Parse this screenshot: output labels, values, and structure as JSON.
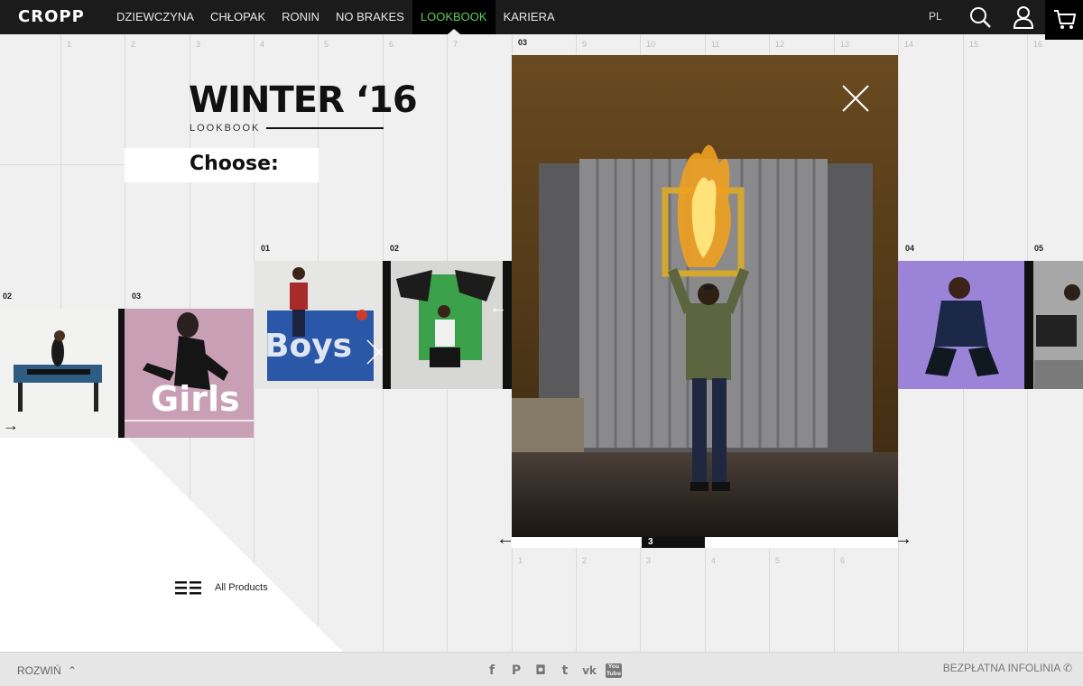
{
  "header": {
    "logo": "CROPP",
    "nav": [
      {
        "label": "DZIEWCZYNA"
      },
      {
        "label": "CHŁOPAK"
      },
      {
        "label": "RONIN"
      },
      {
        "label": "NO BRAKES"
      },
      {
        "label": "LOOKBOOK",
        "active": true
      },
      {
        "label": "KARIERA"
      }
    ],
    "language": "PL"
  },
  "grid": {
    "top_numbers": [
      "1",
      "2",
      "3",
      "4",
      "5",
      "6",
      "7",
      "03",
      "9",
      "10",
      "11",
      "12",
      "13",
      "14",
      "15",
      "16"
    ],
    "bottom_numbers": [
      "1",
      "2",
      "3",
      "4",
      "5",
      "6"
    ]
  },
  "lookbook": {
    "title": "WINTER ‘16",
    "subtitle": "LOOKBOOK",
    "choose": "Choose:"
  },
  "thumbnails": {
    "girls_1_number": "02",
    "girls_2_number": "03",
    "girls_caption": "Girls",
    "boys_1_number": "01",
    "boys_2_number": "02",
    "boys_caption": "Boys",
    "right_1_number": "04",
    "right_2_number": "05"
  },
  "main": {
    "pager_current": "3"
  },
  "all_products": "All Products",
  "footer": {
    "expand": "ROZWIŃ",
    "social": [
      "f",
      "P",
      "◘",
      "t",
      "vk",
      "You Tube"
    ],
    "hotline": "BEZPŁATNA INFOLINIA"
  },
  "colors": {
    "nav_bg": "#1b1b1b",
    "active_nav": "#5ccf58",
    "background": "#f0f0f0"
  }
}
